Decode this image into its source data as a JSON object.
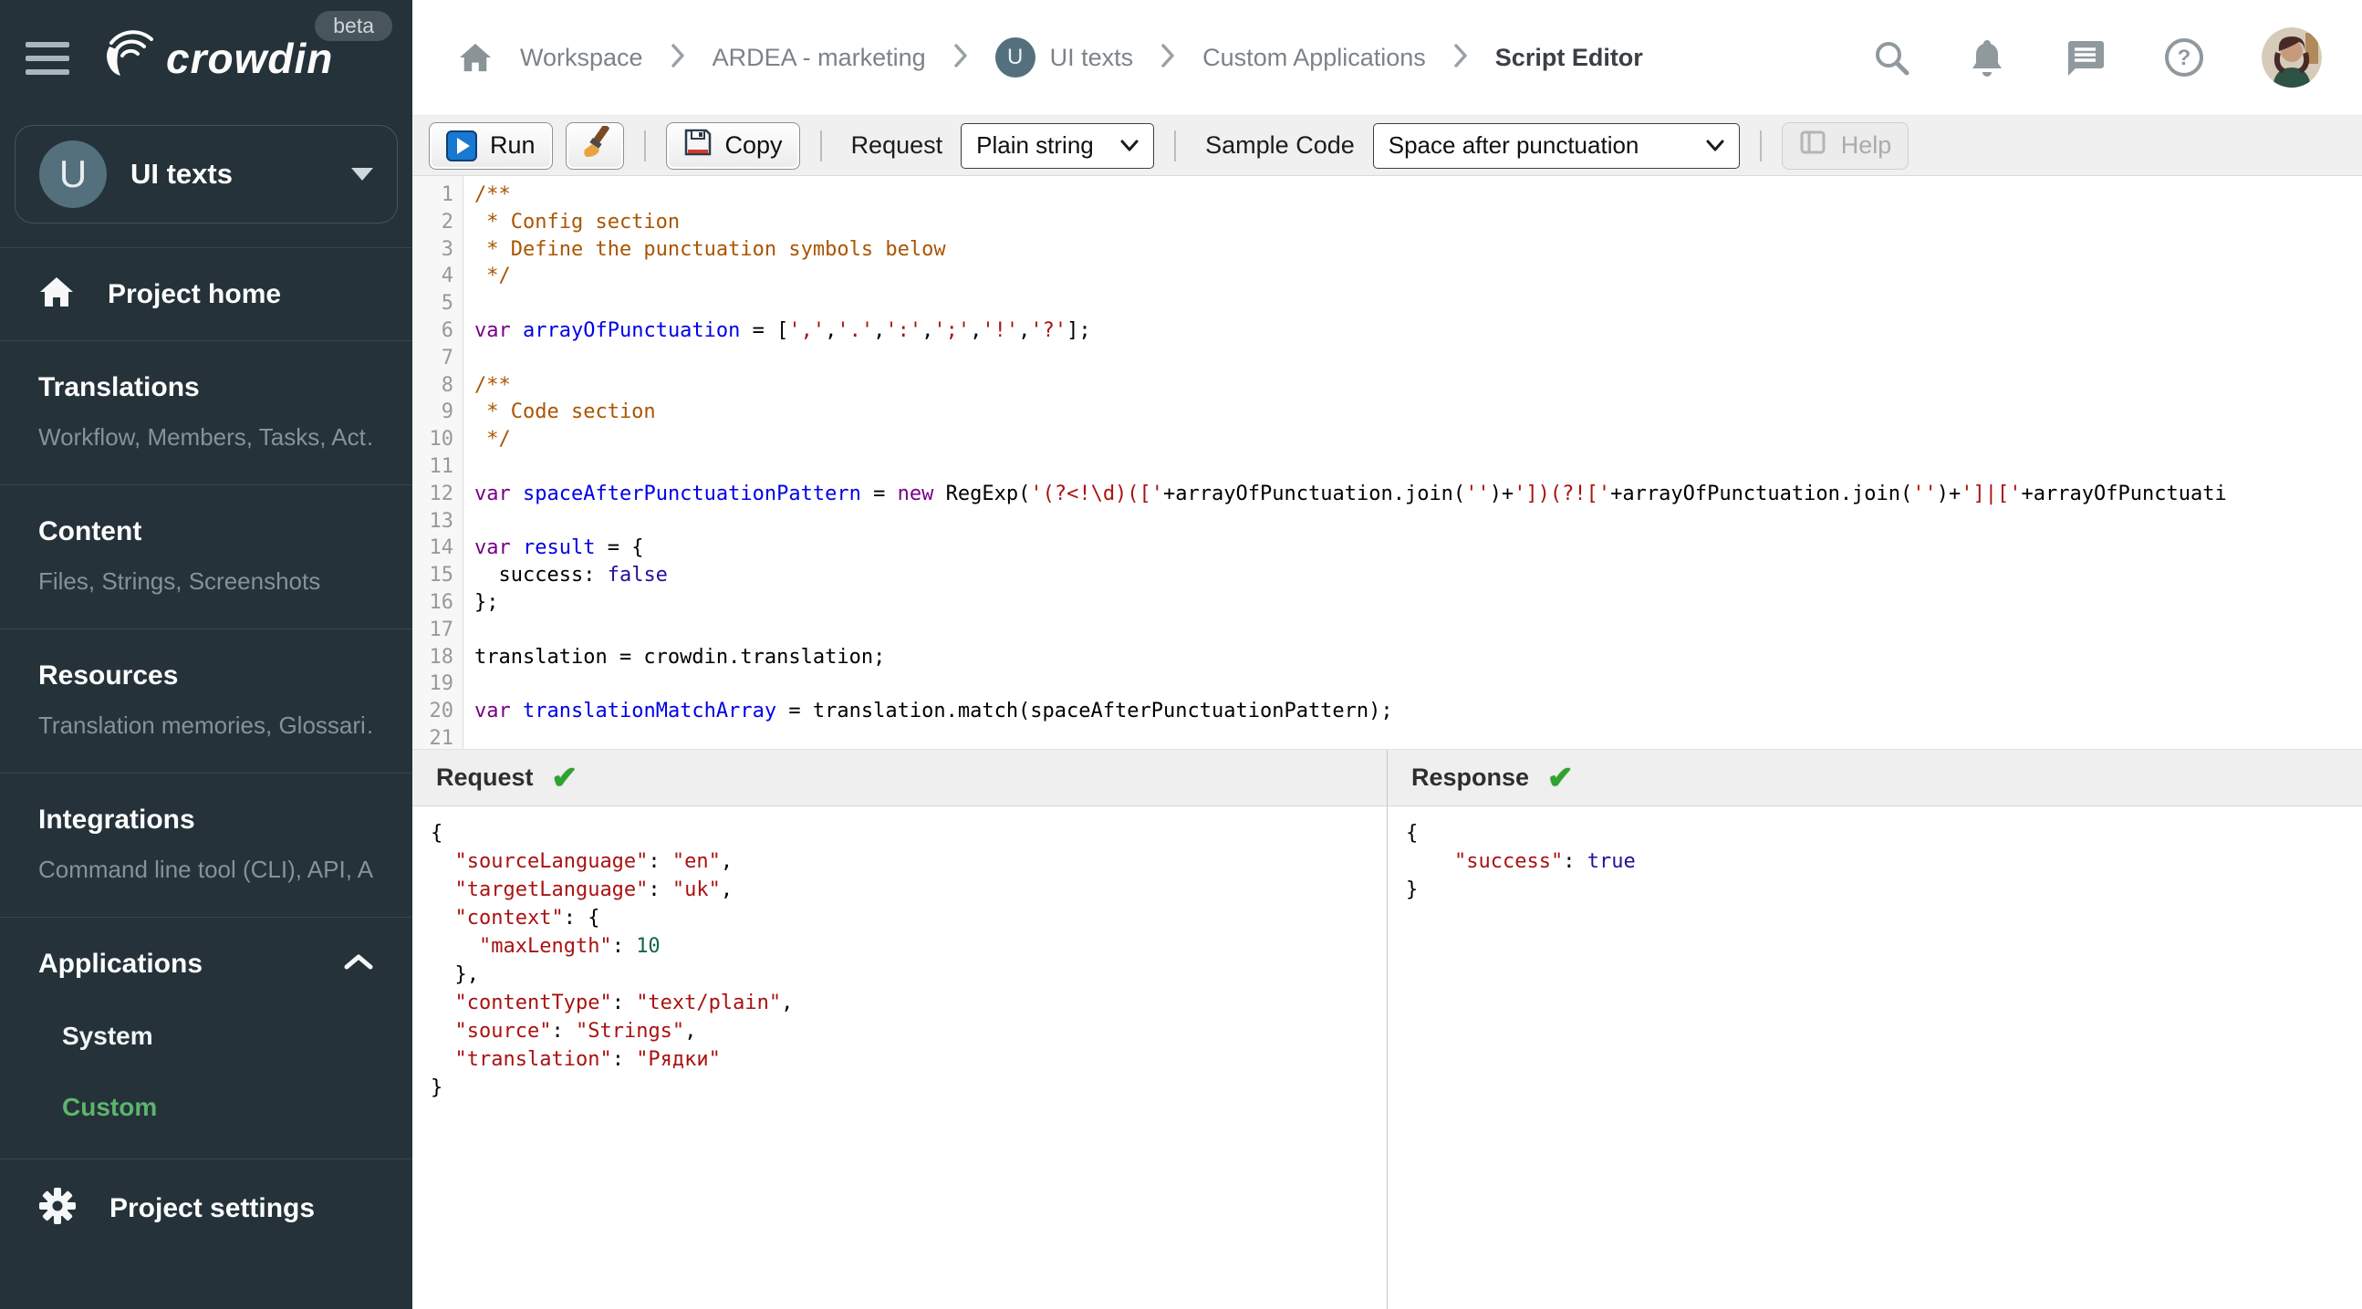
{
  "app": {
    "logo_text": "crowdin",
    "beta_label": "beta"
  },
  "colors": {
    "sidebar_bg": "#25323a",
    "accent_green": "#5cb56c",
    "run_icon_blue": "#1878d2",
    "check_green": "#2fa32f",
    "code_comment": "#aa5500",
    "code_keyword": "#770088",
    "code_def": "#0000e6",
    "code_string": "#aa1111",
    "code_atom": "#221199",
    "code_number": "#116644"
  },
  "header": {
    "breadcrumb": [
      {
        "label": "Workspace"
      },
      {
        "label": "ARDEA - marketing"
      },
      {
        "label": "UI texts",
        "chip": "U"
      },
      {
        "label": "Custom Applications"
      },
      {
        "label": "Script Editor"
      }
    ]
  },
  "sidebar": {
    "project": {
      "initial": "U",
      "name": "UI texts"
    },
    "project_home_label": "Project home",
    "sections": [
      {
        "title": "Translations",
        "subtitle": "Workflow, Members, Tasks, Act…"
      },
      {
        "title": "Content",
        "subtitle": "Files, Strings, Screenshots"
      },
      {
        "title": "Resources",
        "subtitle": "Translation memories, Glossari…"
      },
      {
        "title": "Integrations",
        "subtitle": "Command line tool (CLI), API, A…"
      }
    ],
    "applications": {
      "title": "Applications",
      "items": [
        {
          "label": "System",
          "active": false
        },
        {
          "label": "Custom",
          "active": true
        }
      ]
    },
    "project_settings_label": "Project settings"
  },
  "toolbar": {
    "run_label": "Run",
    "copy_label": "Copy",
    "request_label": "Request",
    "request_value": "Plain string",
    "sample_code_label": "Sample Code",
    "sample_code_value": "Space after punctuation",
    "help_label": "Help"
  },
  "editor": {
    "line_numbers": [
      "1",
      "2",
      "3",
      "4",
      "5",
      "6",
      "7",
      "8",
      "9",
      "10",
      "11",
      "12",
      "13",
      "14",
      "15",
      "16",
      "17",
      "18",
      "19",
      "20",
      "21"
    ],
    "lines": [
      [
        [
          "comment",
          "/**"
        ]
      ],
      [
        [
          "comment",
          " * Config section"
        ]
      ],
      [
        [
          "comment",
          " * Define the punctuation symbols below"
        ]
      ],
      [
        [
          "comment",
          " */"
        ]
      ],
      [],
      [
        [
          "keyword",
          "var"
        ],
        [
          "plain",
          " "
        ],
        [
          "def",
          "arrayOfPunctuation"
        ],
        [
          "plain",
          " = ["
        ],
        [
          "string",
          "','"
        ],
        [
          "plain",
          ","
        ],
        [
          "string",
          "'.'"
        ],
        [
          "plain",
          ","
        ],
        [
          "string",
          "':'"
        ],
        [
          "plain",
          ","
        ],
        [
          "string",
          "';'"
        ],
        [
          "plain",
          ","
        ],
        [
          "string",
          "'!'"
        ],
        [
          "plain",
          ","
        ],
        [
          "string",
          "'?'"
        ],
        [
          "plain",
          "];"
        ]
      ],
      [],
      [
        [
          "comment",
          "/**"
        ]
      ],
      [
        [
          "comment",
          " * Code section"
        ]
      ],
      [
        [
          "comment",
          " */"
        ]
      ],
      [],
      [
        [
          "keyword",
          "var"
        ],
        [
          "plain",
          " "
        ],
        [
          "def",
          "spaceAfterPunctuationPattern"
        ],
        [
          "plain",
          " = "
        ],
        [
          "keyword",
          "new"
        ],
        [
          "plain",
          " RegExp("
        ],
        [
          "string",
          "'(?<!\\d)(['"
        ],
        [
          "plain",
          "+arrayOfPunctuation.join("
        ],
        [
          "string",
          "''"
        ],
        [
          "plain",
          ")+"
        ],
        [
          "string",
          "'])(?!['"
        ],
        [
          "plain",
          "+arrayOfPunctuation.join("
        ],
        [
          "string",
          "''"
        ],
        [
          "plain",
          ")+"
        ],
        [
          "string",
          "']|['"
        ],
        [
          "plain",
          "+arrayOfPunctuati"
        ]
      ],
      [],
      [
        [
          "keyword",
          "var"
        ],
        [
          "plain",
          " "
        ],
        [
          "def",
          "result"
        ],
        [
          "plain",
          " = {"
        ]
      ],
      [
        [
          "plain",
          "  success: "
        ],
        [
          "atom",
          "false"
        ]
      ],
      [
        [
          "plain",
          "};"
        ]
      ],
      [],
      [
        [
          "plain",
          "translation = crowdin.translation;"
        ]
      ],
      [],
      [
        [
          "keyword",
          "var"
        ],
        [
          "plain",
          " "
        ],
        [
          "def",
          "translationMatchArray"
        ],
        [
          "plain",
          " = translation.match(spaceAfterPunctuationPattern);"
        ]
      ],
      []
    ]
  },
  "request_panel": {
    "title": "Request",
    "status": "success",
    "lines": [
      [
        [
          "plain",
          "{"
        ]
      ],
      [
        [
          "plain",
          "  "
        ],
        [
          "string",
          "\"sourceLanguage\""
        ],
        [
          "plain",
          ": "
        ],
        [
          "string",
          "\"en\""
        ],
        [
          "plain",
          ","
        ]
      ],
      [
        [
          "plain",
          "  "
        ],
        [
          "string",
          "\"targetLanguage\""
        ],
        [
          "plain",
          ": "
        ],
        [
          "string",
          "\"uk\""
        ],
        [
          "plain",
          ","
        ]
      ],
      [
        [
          "plain",
          "  "
        ],
        [
          "string",
          "\"context\""
        ],
        [
          "plain",
          ": {"
        ]
      ],
      [
        [
          "plain",
          "    "
        ],
        [
          "string",
          "\"maxLength\""
        ],
        [
          "plain",
          ": "
        ],
        [
          "number",
          "10"
        ]
      ],
      [
        [
          "plain",
          "  },"
        ]
      ],
      [
        [
          "plain",
          "  "
        ],
        [
          "string",
          "\"contentType\""
        ],
        [
          "plain",
          ": "
        ],
        [
          "string",
          "\"text/plain\""
        ],
        [
          "plain",
          ","
        ]
      ],
      [
        [
          "plain",
          "  "
        ],
        [
          "string",
          "\"source\""
        ],
        [
          "plain",
          ": "
        ],
        [
          "string",
          "\"Strings\""
        ],
        [
          "plain",
          ","
        ]
      ],
      [
        [
          "plain",
          "  "
        ],
        [
          "string",
          "\"translation\""
        ],
        [
          "plain",
          ": "
        ],
        [
          "string",
          "\"Рядки\""
        ]
      ],
      [
        [
          "plain",
          "}"
        ]
      ]
    ]
  },
  "response_panel": {
    "title": "Response",
    "status": "success",
    "lines": [
      [
        [
          "plain",
          "{"
        ]
      ],
      [
        [
          "plain",
          "    "
        ],
        [
          "string",
          "\"success\""
        ],
        [
          "plain",
          ": "
        ],
        [
          "atom",
          "true"
        ]
      ],
      [
        [
          "plain",
          "}"
        ]
      ]
    ]
  }
}
